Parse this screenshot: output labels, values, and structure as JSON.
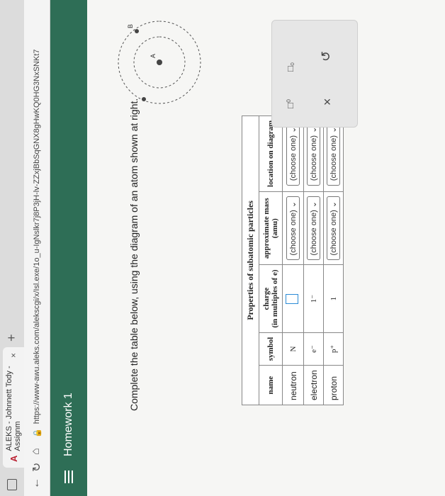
{
  "browser": {
    "tab_title": "ALEKS - Johnnett Tody - Assignm",
    "tab_favicon": "A",
    "url": "https://www-awu.aleks.com/alekscgi/x/Isl.exe/1o_u-IgNslkr7j8P3jH-lv-ZZxjBbSqGNX8gHwKQ0HG3NxSNKt7"
  },
  "header": {
    "title": "Homework 1"
  },
  "main": {
    "prompt": "Complete the table below, using the diagram of an atom shown at right.",
    "atom_labels": {
      "a": "A",
      "b": "B"
    }
  },
  "table": {
    "caption": "Properties of subatomic particles",
    "headers": {
      "name": "name",
      "symbol": "symbol",
      "charge": "charge",
      "charge_sub": "(in multiples of e)",
      "mass": "approximate mass",
      "mass_sub": "(amu)",
      "location": "location on diagram"
    },
    "rows": [
      {
        "name": "neutron",
        "symbol": "N",
        "charge": "",
        "mass": "(choose one)",
        "location": "(choose one)"
      },
      {
        "name": "electron",
        "symbol": "e⁻",
        "charge": "1⁻",
        "mass": "(choose one)",
        "location": "(choose one)"
      },
      {
        "name": "proton",
        "symbol": "p⁺",
        "charge": "1",
        "mass": "(choose one)",
        "location": "(choose one)"
      }
    ]
  },
  "toolbox": {
    "undo_icon": "undo-icon",
    "clear_icon": "close-icon"
  },
  "colors": {
    "header": "#2e6e56",
    "accent": "#2b8bd6"
  }
}
